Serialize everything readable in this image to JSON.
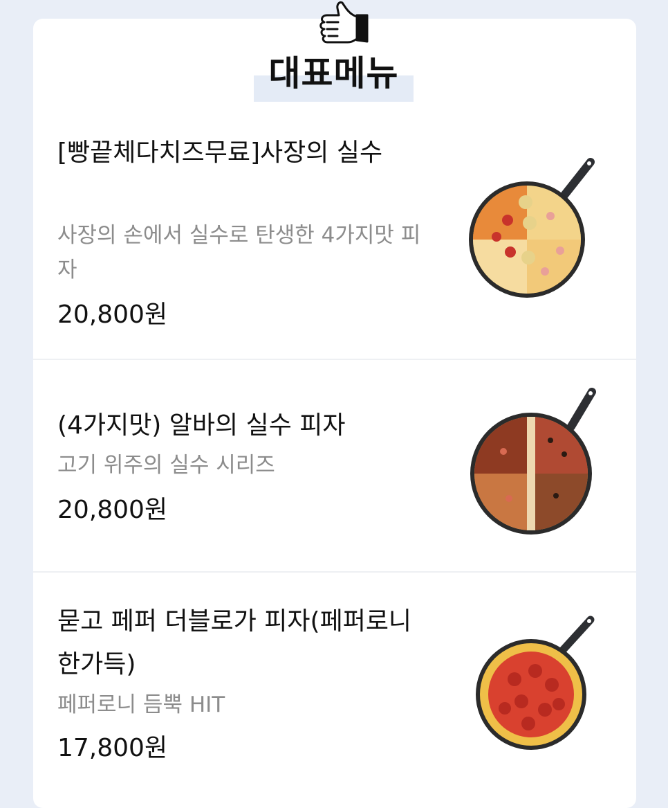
{
  "section": {
    "title": "대표메뉴",
    "icon": "thumbs-up-icon"
  },
  "menu": {
    "items": [
      {
        "name": "[빵끝체다치즈무료]사장의 실수",
        "description": "사장의 손에서 실수로 탄생한 4가지맛 피자",
        "price": "20,800원",
        "image": "four-quarter-pizza-pan-image"
      },
      {
        "name": "(4가지맛) 알바의 실수 피자",
        "description": "고기 위주의 실수 시리즈",
        "price": "20,800원",
        "image": "meat-four-quarter-pizza-pan-image"
      },
      {
        "name": "묻고 페퍼 더블로가 피자(페퍼로니 한가득)",
        "description": "페퍼로니 듬뿍 HIT",
        "price": "17,800원",
        "image": "pepperoni-pizza-pan-image"
      }
    ]
  },
  "colors": {
    "page_background": "#e9eef7",
    "card_background": "#ffffff",
    "title_highlight": "#e4ebf6",
    "text_primary": "#111111",
    "text_secondary": "#8c8c8c"
  }
}
